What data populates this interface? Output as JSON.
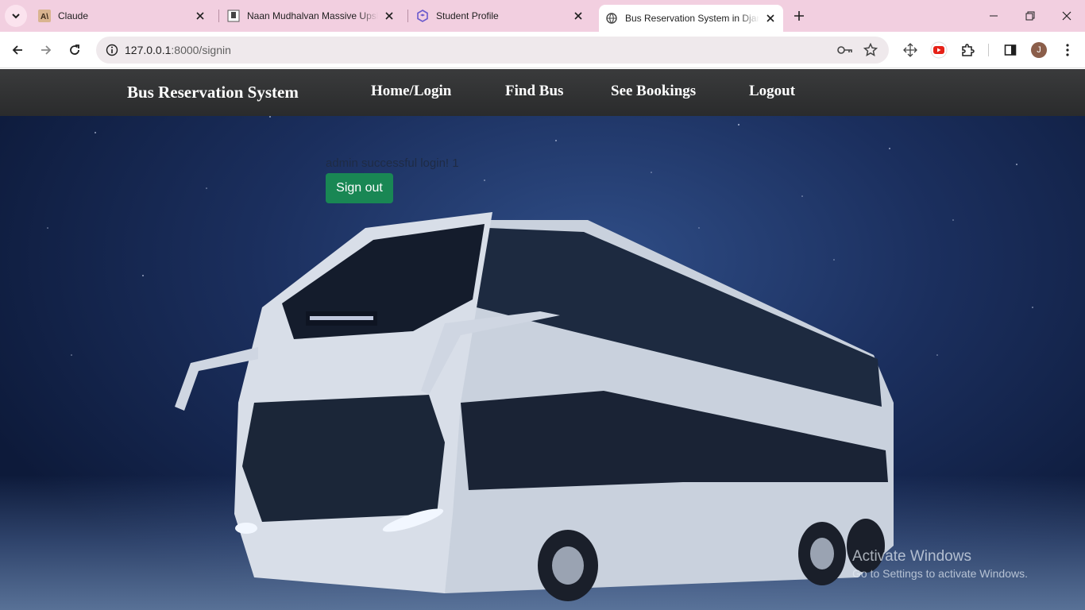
{
  "browser": {
    "tabs": [
      {
        "title": "Claude",
        "icon": "claude-icon",
        "active": false
      },
      {
        "title": "Naan Mudhalvan Massive Upskilling",
        "icon": "naan-mudhalvan-icon",
        "active": false
      },
      {
        "title": "Student Profile",
        "icon": "hex-icon",
        "active": false
      },
      {
        "title": "Bus Reservation System in Django",
        "icon": "globe-icon",
        "active": true
      }
    ],
    "url_host": "127.0.0.1",
    "url_rest": ":8000/signin",
    "profile_initial": "J"
  },
  "navbar": {
    "brand": "Bus Reservation System",
    "links": [
      "Home/Login",
      "Find Bus",
      "See Bookings",
      "Logout"
    ]
  },
  "main": {
    "message": "admin successful login! 1",
    "signout_label": "Sign out"
  },
  "watermark": {
    "line1": "Activate Windows",
    "line2": "Go to Settings to activate Windows."
  },
  "colors": {
    "tabstrip": "#f2cfe0",
    "navbar": "#323334",
    "signout_button": "#198754"
  }
}
